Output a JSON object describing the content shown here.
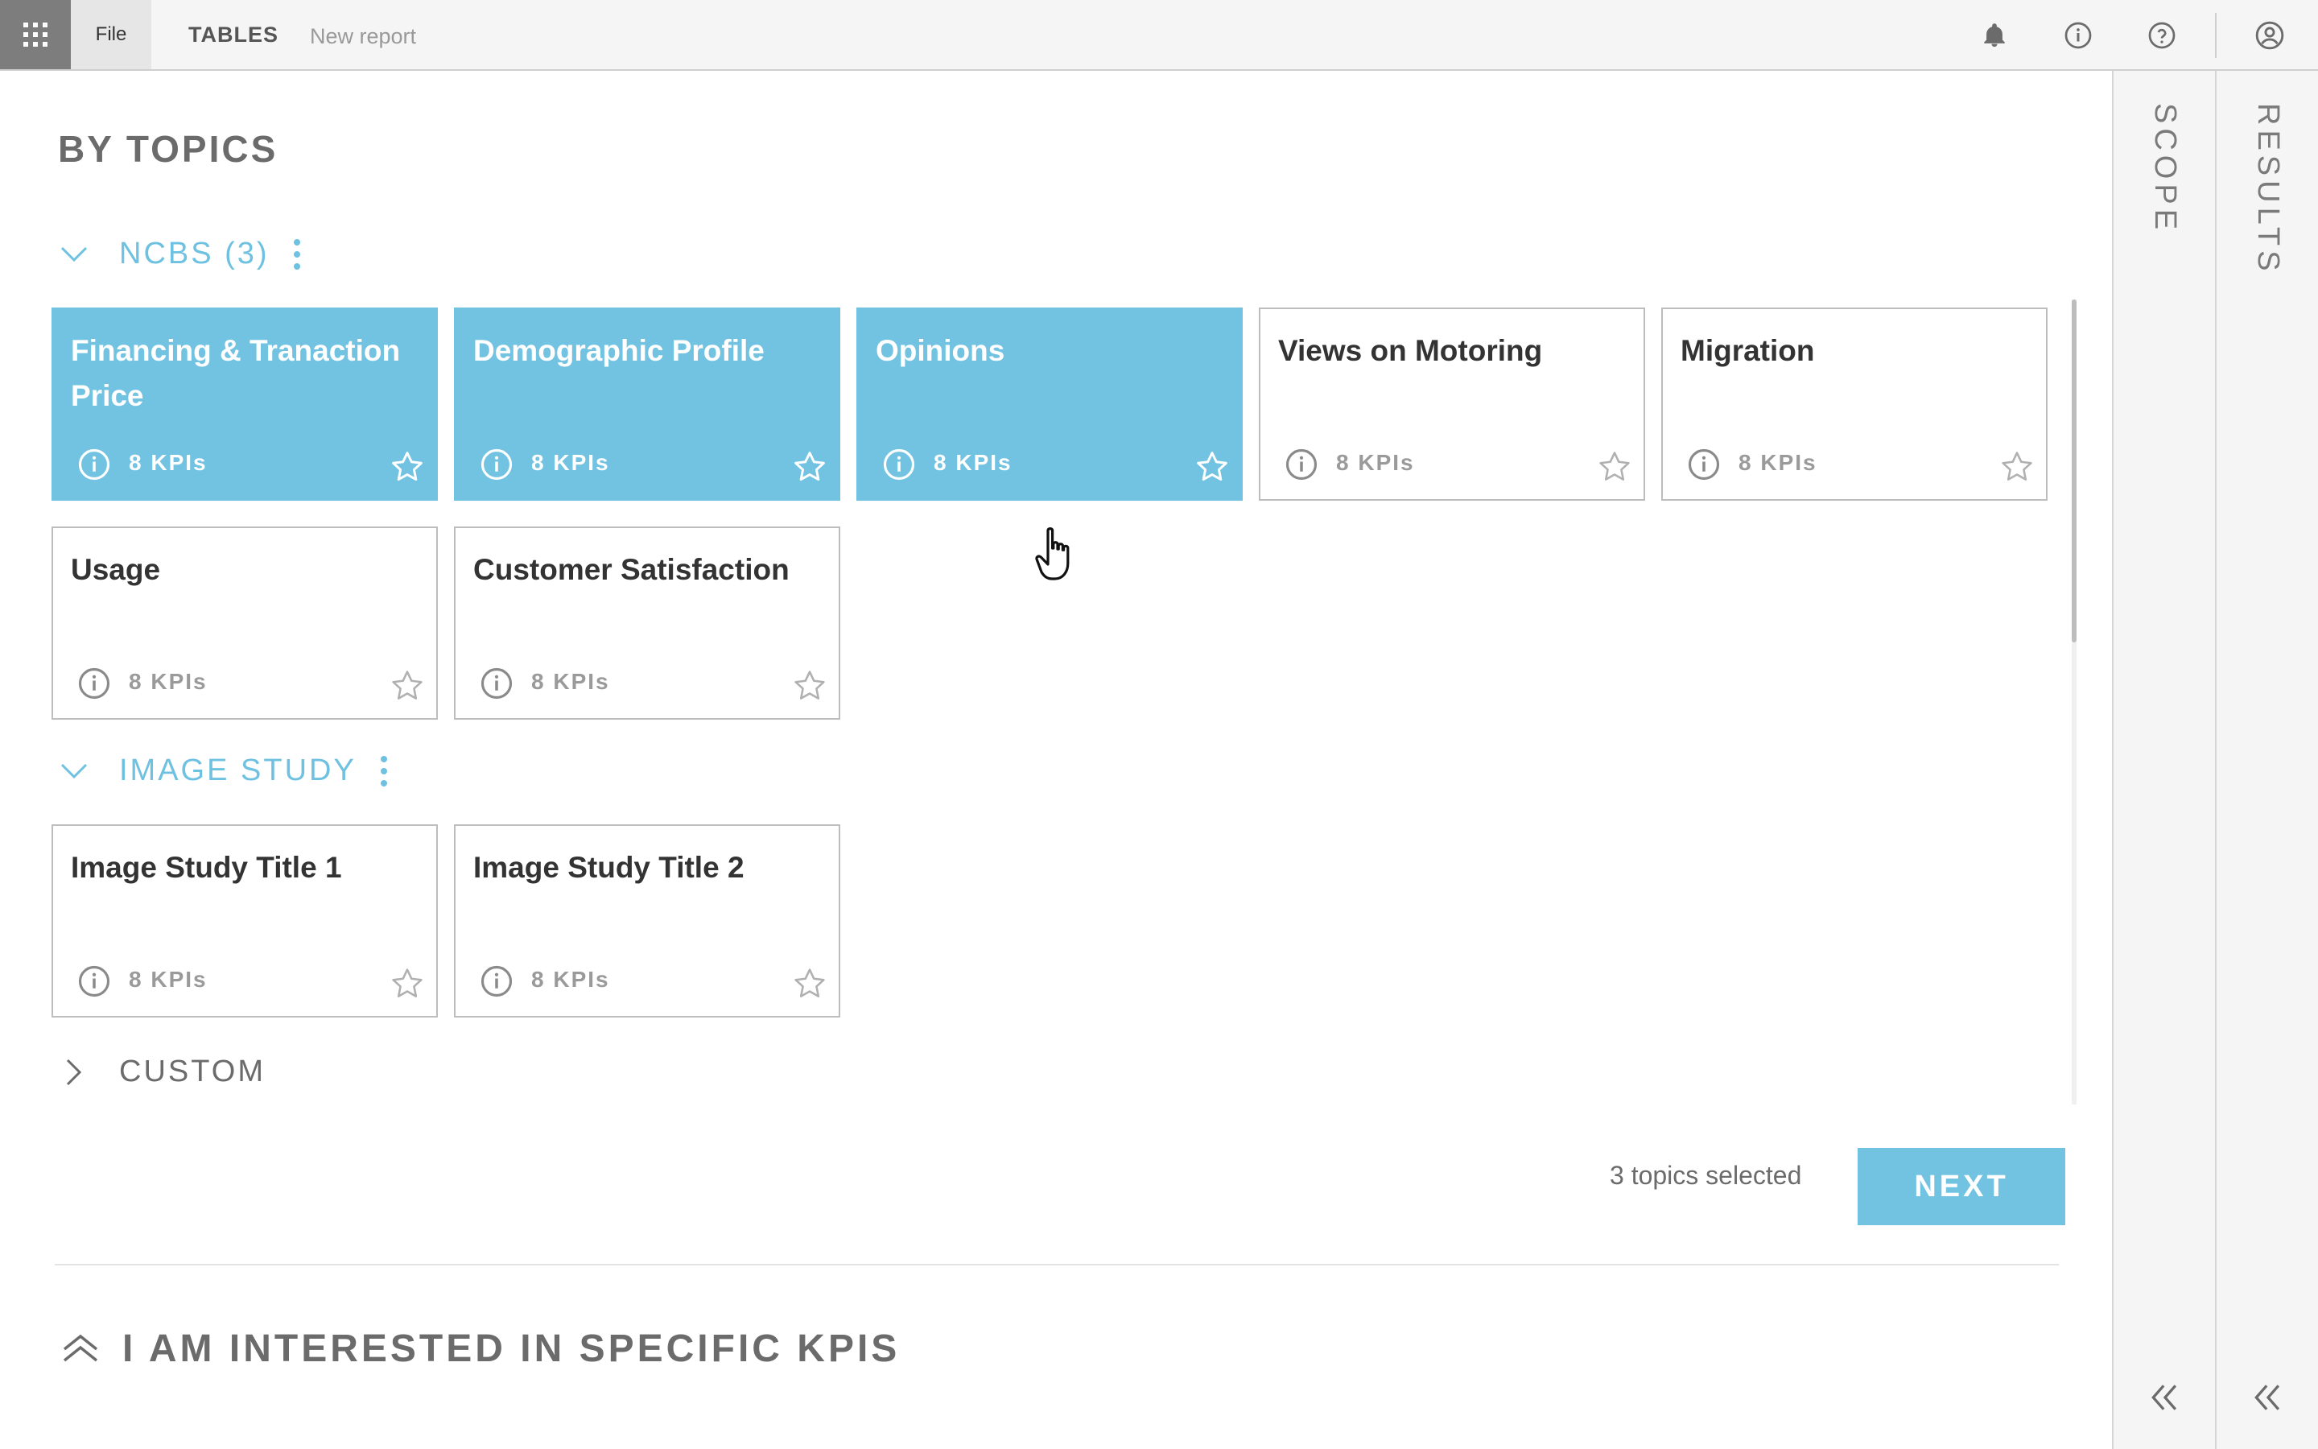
{
  "topbar": {
    "apps_icon": "apps-grid-icon",
    "file_label": "File",
    "tables_label": "TABLES",
    "report_name": "New report",
    "icons": [
      "bell-icon",
      "info-icon",
      "help-icon",
      "user-account-icon"
    ]
  },
  "page": {
    "title": "BY TOPICS"
  },
  "sections": [
    {
      "label": "NCBS (3)",
      "expanded": true,
      "cards": [
        {
          "title": "Financing & Tranaction Price",
          "kpis": "8 KPIs",
          "selected": true
        },
        {
          "title": "Demographic Profile",
          "kpis": "8 KPIs",
          "selected": true
        },
        {
          "title": "Opinions",
          "kpis": "8 KPIs",
          "selected": true
        },
        {
          "title": "Views on Motoring",
          "kpis": "8 KPIs",
          "selected": false
        },
        {
          "title": "Migration",
          "kpis": "8 KPIs",
          "selected": false
        },
        {
          "title": "Usage",
          "kpis": "8 KPIs",
          "selected": false
        },
        {
          "title": "Customer Satisfaction",
          "kpis": "8 KPIs",
          "selected": false
        }
      ]
    },
    {
      "label": "IMAGE STUDY",
      "expanded": true,
      "cards": [
        {
          "title": "Image Study Title 1",
          "kpis": "8 KPIs",
          "selected": false
        },
        {
          "title": "Image Study Title 2",
          "kpis": "8 KPIs",
          "selected": false
        }
      ]
    },
    {
      "label": "CUSTOM",
      "expanded": false,
      "cards": []
    }
  ],
  "footer": {
    "selected_text": "3 topics selected",
    "next_label": "NEXT"
  },
  "kpi_section": {
    "title": "I AM INTERESTED IN SPECIFIC KPIS"
  },
  "rails": {
    "scope_label": "SCOPE",
    "results_label": "RESULTS"
  },
  "colors": {
    "accent": "#72c3e2",
    "accent_text": "#6ec1e0",
    "muted_text": "#6b6b6b"
  }
}
